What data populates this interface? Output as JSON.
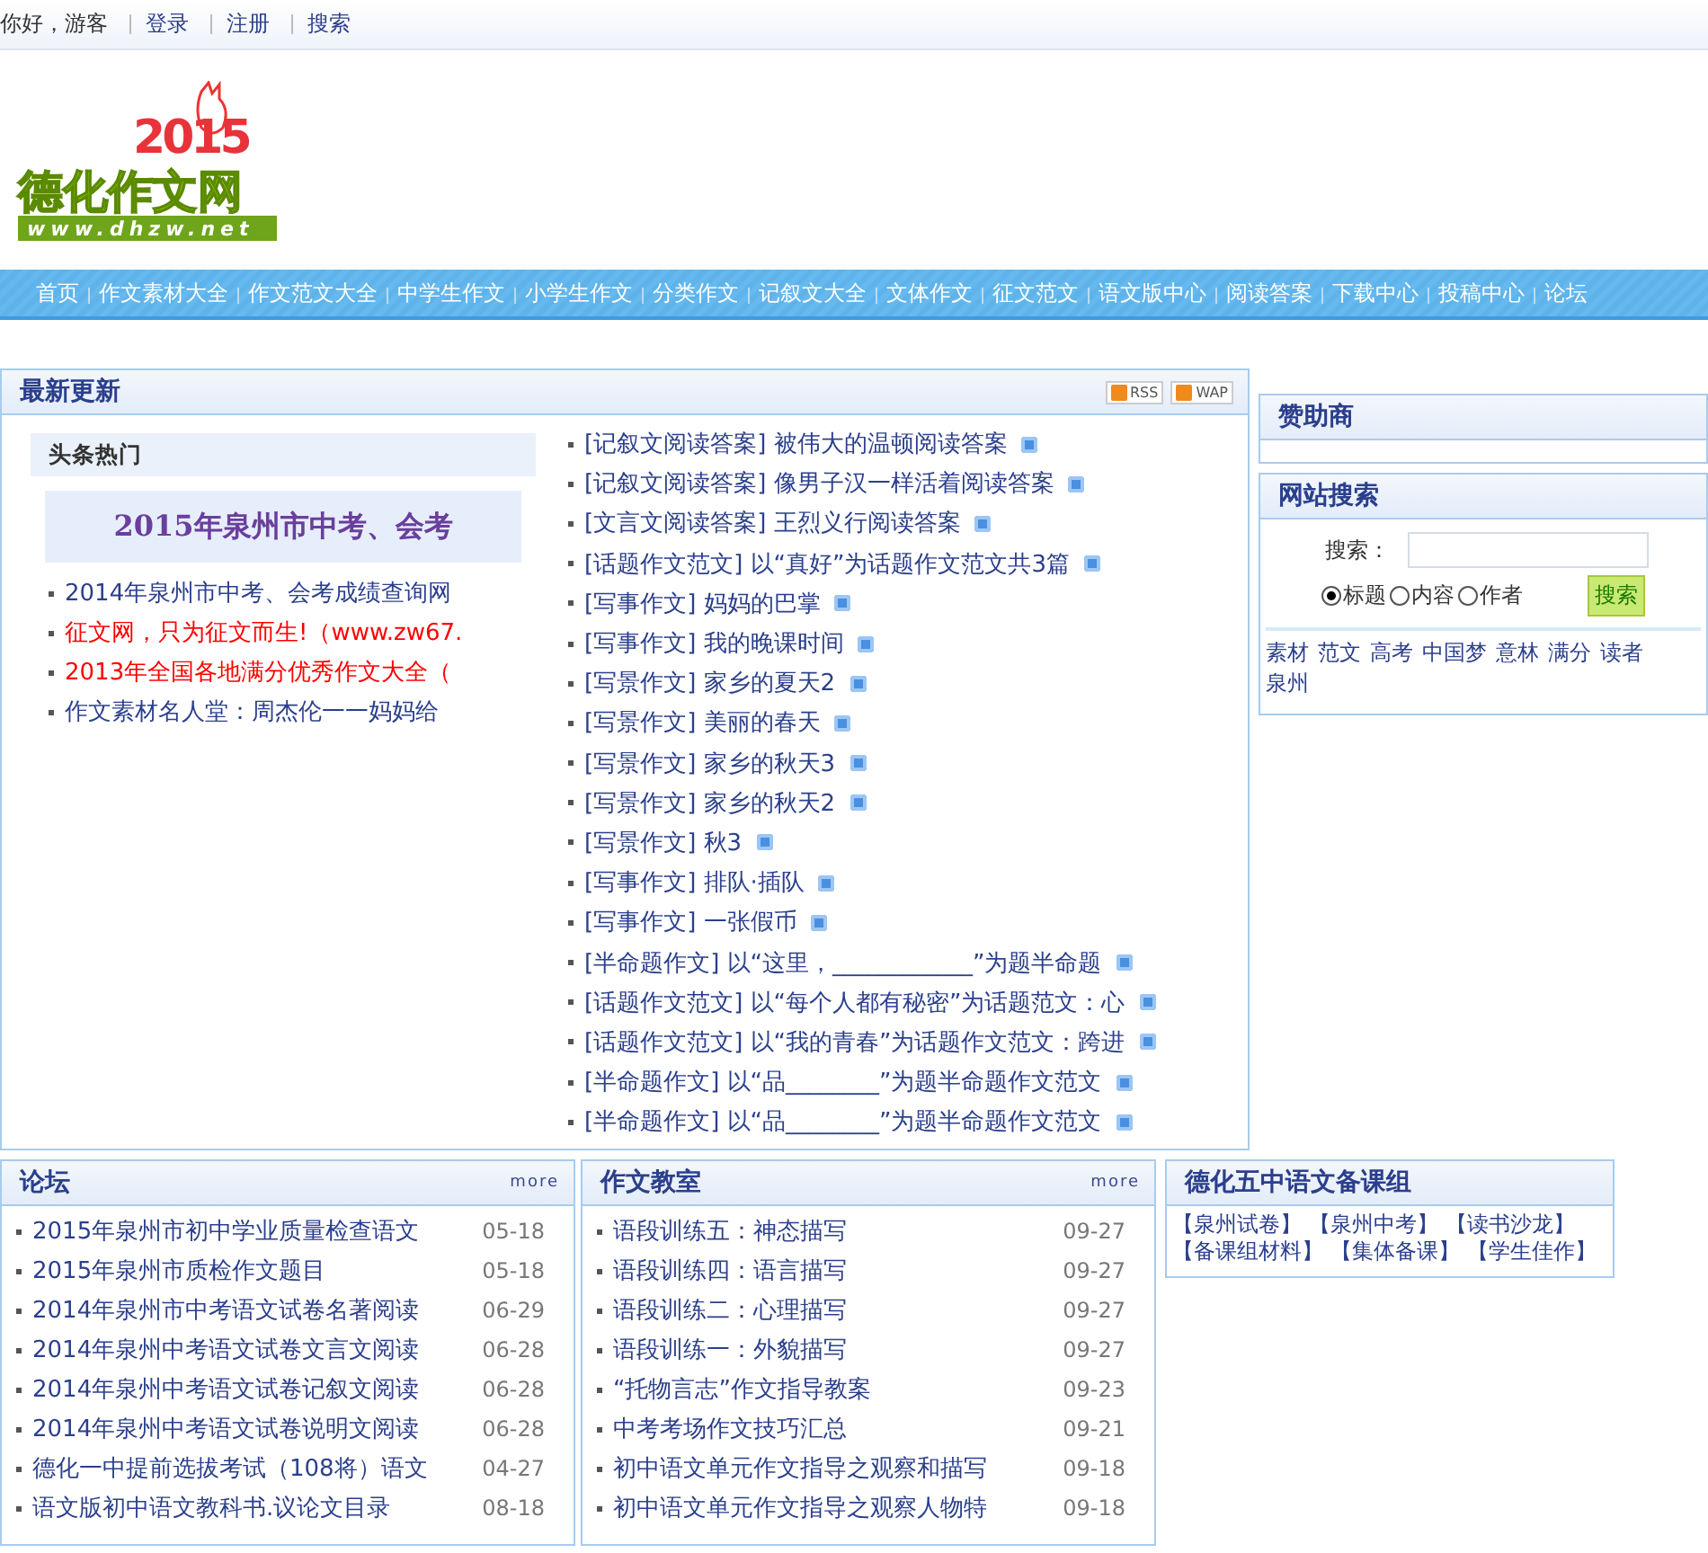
{
  "topbar": {
    "greeting": "你好，游客",
    "links": [
      "登录",
      "注册",
      "搜索"
    ]
  },
  "logo": {
    "year": "2015",
    "title": "德化作文网",
    "url": "www.dhzw.net"
  },
  "nav": [
    "首页",
    "作文素材大全",
    "作文范文大全",
    "中学生作文",
    "小学生作文",
    "分类作文",
    "记叙文大全",
    "文体作文",
    "征文范文",
    "语文版中心",
    "阅读答案",
    "下载中心",
    "投稿中心",
    "论坛"
  ],
  "latest": {
    "title": "最新更新",
    "badges": [
      "RSS",
      "WAP"
    ],
    "headline": {
      "title": "头条热门",
      "banner": "2015年泉州市中考、会考",
      "items": [
        {
          "text": "2014年泉州市中考、会考成绩查询网",
          "color": "#2b3f8c"
        },
        {
          "text": "征文网，只为征文而生!（www.zw67.",
          "color": "#ff0000"
        },
        {
          "text": "2013年全国各地满分优秀作文大全（",
          "color": "#ff0000"
        },
        {
          "text": "作文素材名人堂：周杰伦一一妈妈给",
          "color": "#2b3f8c"
        }
      ]
    },
    "items": [
      {
        "category": "[记叙文阅读答案]",
        "title": "被伟大的温顿阅读答案",
        "new": true
      },
      {
        "category": "[记叙文阅读答案]",
        "title": "像男子汉一样活着阅读答案",
        "new": true
      },
      {
        "category": "[文言文阅读答案]",
        "title": "王烈义行阅读答案",
        "new": true
      },
      {
        "category": "[话题作文范文]",
        "title": "以“真好”为话题作文范文共3篇",
        "new": true
      },
      {
        "category": "[写事作文]",
        "title": "妈妈的巴掌",
        "new": true
      },
      {
        "category": "[写事作文]",
        "title": "我的晚课时间",
        "new": true
      },
      {
        "category": "[写景作文]",
        "title": "家乡的夏天2",
        "new": true
      },
      {
        "category": "[写景作文]",
        "title": "美丽的春天",
        "new": true
      },
      {
        "category": "[写景作文]",
        "title": "家乡的秋天3",
        "new": true
      },
      {
        "category": "[写景作文]",
        "title": "家乡的秋天2",
        "new": true
      },
      {
        "category": "[写景作文]",
        "title": "秋3",
        "new": true
      },
      {
        "category": "[写事作文]",
        "title": "排队·插队",
        "new": true
      },
      {
        "category": "[写事作文]",
        "title": "一张假币",
        "new": true
      },
      {
        "category": "[半命题作文]",
        "title": "以“这里，____________”为题半命题",
        "new": true
      },
      {
        "category": "[话题作文范文]",
        "title": "以“每个人都有秘密”为话题范文：心",
        "new": true
      },
      {
        "category": "[话题作文范文]",
        "title": "以“我的青春”为话题作文范文：跨进",
        "new": true
      },
      {
        "category": "[半命题作文]",
        "title": "以“品________”为题半命题作文范文",
        "new": true
      },
      {
        "category": "[半命题作文]",
        "title": "以“品________”为题半命题作文范文",
        "new": true
      }
    ]
  },
  "sponsor": {
    "title": "赞助商"
  },
  "site_search": {
    "title": "网站搜索",
    "label": "搜索：",
    "options": [
      {
        "label": "标题",
        "selected": true
      },
      {
        "label": "内容",
        "selected": false
      },
      {
        "label": "作者",
        "selected": false
      }
    ],
    "button": "搜索",
    "keywords": [
      "素材",
      "范文",
      "高考",
      "中国梦",
      "意林",
      "满分",
      "读者",
      "泉州"
    ]
  },
  "forum": {
    "title": "论坛",
    "more": "more",
    "items": [
      {
        "title": "2015年泉州市初中学业质量检查语文",
        "date": "05-18"
      },
      {
        "title": "2015年泉州市质检作文题目",
        "date": "05-18"
      },
      {
        "title": "2014年泉州市中考语文试卷名著阅读",
        "date": "06-29"
      },
      {
        "title": "2014年泉州中考语文试卷文言文阅读",
        "date": "06-28"
      },
      {
        "title": "2014年泉州中考语文试卷记叙文阅读",
        "date": "06-28"
      },
      {
        "title": "2014年泉州中考语文试卷说明文阅读",
        "date": "06-28"
      },
      {
        "title": "德化一中提前选拔考试（108将）语文",
        "date": "04-27"
      },
      {
        "title": "语文版初中语文教科书.议论文目录",
        "date": "08-18"
      }
    ]
  },
  "classroom": {
    "title": "作文教室",
    "more": "more",
    "items": [
      {
        "title": "语段训练五：神态描写",
        "date": "09-27"
      },
      {
        "title": "语段训练四：语言描写",
        "date": "09-27"
      },
      {
        "title": "语段训练二：心理描写",
        "date": "09-27"
      },
      {
        "title": "语段训练一：外貌描写",
        "date": "09-27"
      },
      {
        "title": "“托物言志”作文指导教案",
        "date": "09-23"
      },
      {
        "title": "中考考场作文技巧汇总",
        "date": "09-21"
      },
      {
        "title": "初中语文单元作文指导之观察和描写",
        "date": "09-18"
      },
      {
        "title": "初中语文单元作文指导之观察人物特",
        "date": "09-18"
      }
    ]
  },
  "group": {
    "title": "德化五中语文备课组",
    "links": [
      "【泉州试卷】",
      "【泉州中考】",
      "【读书沙龙】",
      "【备课组材料】",
      "【集体备课】",
      "【学生佳作】"
    ]
  }
}
